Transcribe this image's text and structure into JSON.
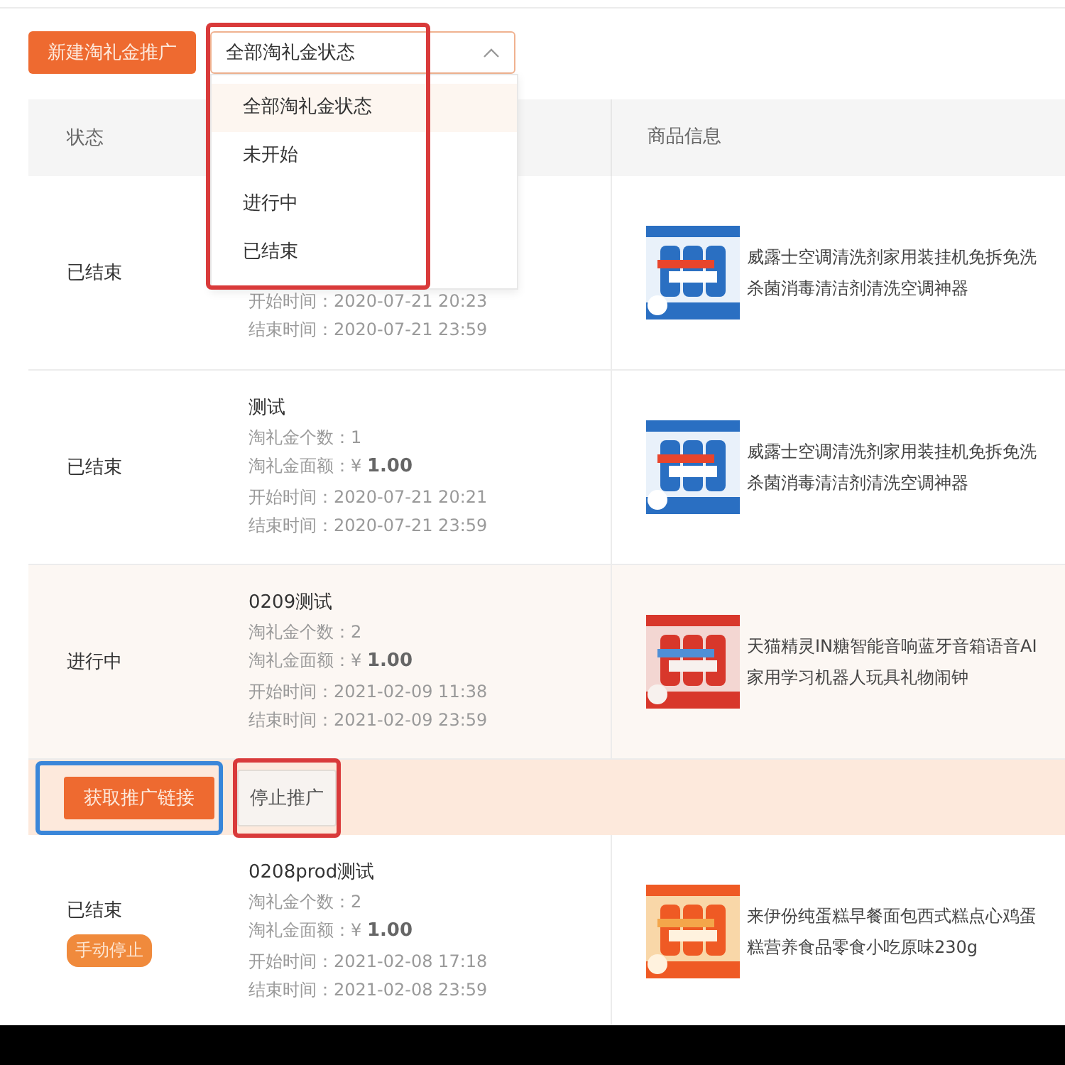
{
  "toolbar": {
    "create_button": "新建淘礼金推广",
    "select": {
      "value": "全部淘礼金状态",
      "expanded": true,
      "highlighted": true,
      "options": [
        {
          "label": "全部淘礼金状态",
          "selected": true
        },
        {
          "label": "未开始",
          "selected": false
        },
        {
          "label": "进行中",
          "selected": false
        },
        {
          "label": "已结束",
          "selected": false
        }
      ]
    }
  },
  "table": {
    "columns": [
      "状态",
      "商品信息"
    ],
    "rows": [
      {
        "status": "已结束",
        "highlighted": false,
        "lines": [
          {
            "kind": "text",
            "label": "开始时间：",
            "value": "2020-07-21 20:23"
          },
          {
            "kind": "text",
            "label": "结束时间：",
            "value": "2020-07-21 23:59"
          }
        ],
        "product": {
          "title": "威露士空调清洗剂家用装挂机免拆免洗杀菌消毒清洁剂清洗空调神器"
        }
      },
      {
        "status": "已结束",
        "name": "测试",
        "highlighted": false,
        "lines": [
          {
            "kind": "text",
            "label": "淘礼金个数：",
            "value": "1"
          },
          {
            "kind": "amount",
            "label": "淘礼金面额：",
            "value": "¥ **1.00**"
          },
          {
            "kind": "text",
            "label": "开始时间：",
            "value": "2020-07-21 20:21"
          },
          {
            "kind": "text",
            "label": "结束时间：",
            "value": "2020-07-21 23:59"
          }
        ],
        "product": {
          "title": "威露士空调清洗剂家用装挂机免拆免洗杀菌消毒清洁剂清洗空调神器"
        }
      },
      {
        "status": "进行中",
        "name": "0209测试",
        "highlighted": true,
        "lines": [
          {
            "kind": "text",
            "label": "淘礼金个数：",
            "value": "2"
          },
          {
            "kind": "amount",
            "label": "淘礼金面额：",
            "value": "¥ **1.00**"
          },
          {
            "kind": "text",
            "label": "开始时间：",
            "value": "2021-02-09 11:38"
          },
          {
            "kind": "text",
            "label": "结束时间：",
            "value": "2021-02-09 23:59"
          }
        ],
        "product": {
          "title": "天猫精灵IN糖智能音响蓝牙音箱语音AI家用学习机器人玩具礼物闹钟"
        },
        "actions": [
          {
            "label": "获取推广链接",
            "kind": "primary",
            "color": "#3a86d9"
          },
          {
            "label": "停止推广",
            "kind": "plain",
            "color": "#d93a3a"
          }
        ]
      },
      {
        "status": "已结束",
        "badge": "手动停止",
        "name": "0208prod测试",
        "highlighted": false,
        "lines": [
          {
            "kind": "text",
            "label": "淘礼金个数：",
            "value": "2"
          },
          {
            "kind": "amount",
            "label": "淘礼金面额：",
            "value": "¥ **1.00**"
          },
          {
            "kind": "text",
            "label": "开始时间：",
            "value": "2021-02-08 17:18"
          },
          {
            "kind": "text",
            "label": "结束时间：",
            "value": "2021-02-08 23:59"
          }
        ],
        "product": {
          "title": "来伊份纯蛋糕早餐面包西式糕点心鸡蛋糕营养食品零食小吃原味230g"
        }
      }
    ]
  }
}
